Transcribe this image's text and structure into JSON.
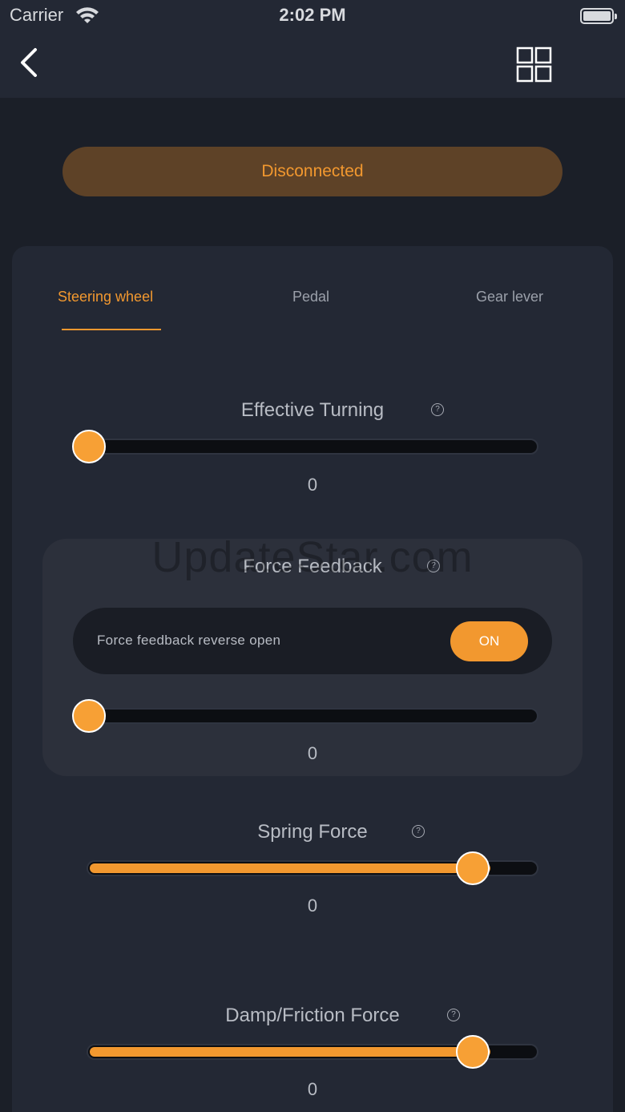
{
  "status_bar": {
    "carrier": "Carrier",
    "time": "2:02 PM"
  },
  "nav": {
    "back_icon": "chevron-left-icon",
    "menu_icon": "grid-icon"
  },
  "connection": {
    "status": "Disconnected"
  },
  "tabs": [
    {
      "label": "Steering wheel",
      "active": true
    },
    {
      "label": "Pedal",
      "active": false
    },
    {
      "label": "Gear lever",
      "active": false
    }
  ],
  "effective_turning": {
    "title": "Effective Turning",
    "help": "?",
    "value": "0",
    "slider_level": 0
  },
  "force_feedback": {
    "title": "Force Feedback",
    "help": "?",
    "reverse_label": "Force feedback reverse open",
    "toggle_label": "ON",
    "value": "0",
    "slider_level": 0
  },
  "spring_force": {
    "title": "Spring Force",
    "help": "?",
    "value": "0",
    "slider_level": 0.9
  },
  "damp_friction": {
    "title": "Damp/Friction Force",
    "help": "?",
    "value": "0",
    "slider_level": 0.9
  },
  "watermark": "UpdateStar.com",
  "colors": {
    "accent": "#f2982f",
    "background": "#1b1f28",
    "panel": "#232834",
    "card": "#2c303b"
  }
}
